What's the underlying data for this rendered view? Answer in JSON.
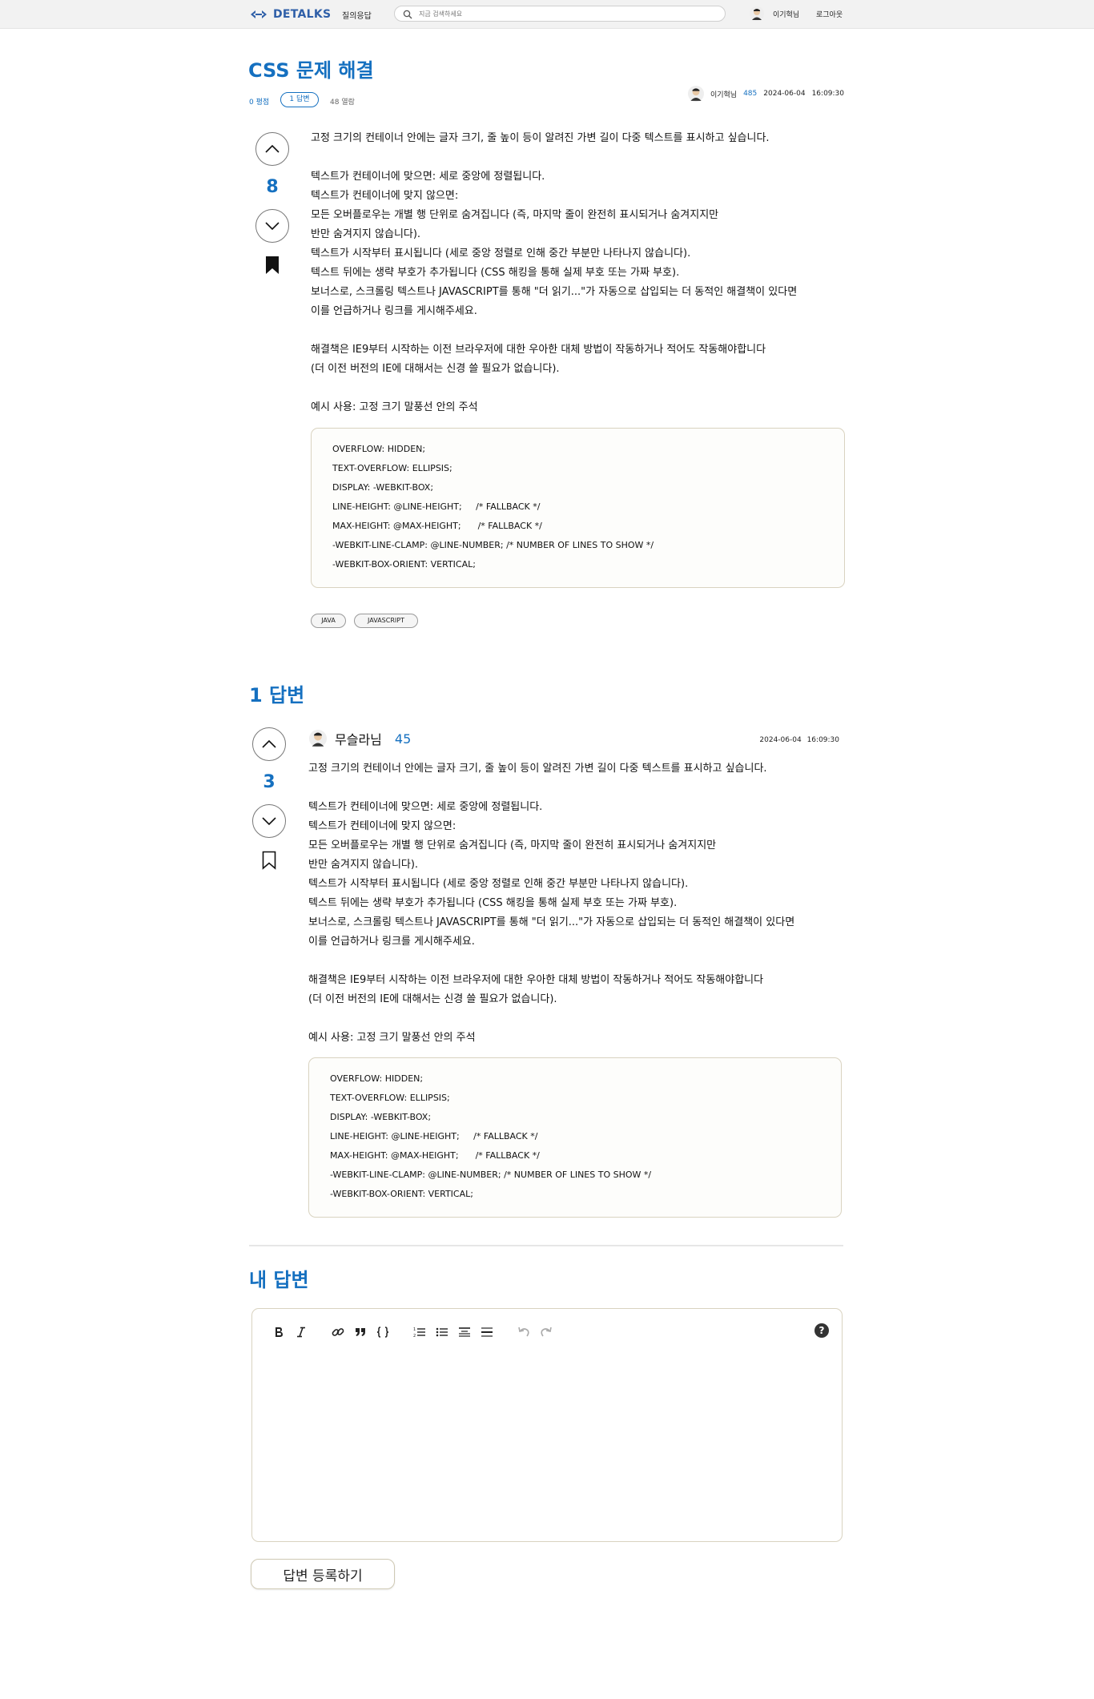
{
  "header": {
    "logo_text": "DETALKS",
    "nav_qa": "질의응답",
    "search_placeholder": "지금 검색하세요",
    "user_name": "이기혁님",
    "logout": "로그아웃"
  },
  "question": {
    "title": "CSS 문제 해결",
    "score": "0 평점",
    "answers": "1 답변",
    "views": "48 열람",
    "author": "이기혁님",
    "reputation": "485",
    "date": "2024-06-04",
    "time": "16:09:30",
    "votes": "8",
    "bookmarked": true,
    "body": "고정 크기의 컨테이너 안에는 글자 크기, 줄 높이 등이 알려진 가변 길이 다중 텍스트를 표시하고 싶습니다.\n\n텍스트가 컨테이너에 맞으면: 세로 중앙에 정렬됩니다.\n텍스트가 컨테이너에 맞지 않으면:\n모든 오버플로우는 개별 행 단위로 숨겨집니다 (즉, 마지막 줄이 완전히 표시되거나 숨겨지지만\n반만 숨겨지지 않습니다).\n텍스트가 시작부터 표시됩니다 (세로 중앙 정렬로 인해 중간 부분만 나타나지 않습니다).\n텍스트 뒤에는 생략 부호가 추가됩니다 (CSS 해킹을 통해 실제 부호 또는 가짜 부호).\n보너스로, 스크롤링 텍스트나 JAVASCRIPT를 통해 \"더 읽기...\"가 자동으로 삽입되는 더 동적인 해결책이 있다면\n이를 언급하거나 링크를 게시해주세요.\n\n해결책은 IE9부터 시작하는 이전 브라우저에 대한 우아한 대체 방법이 작동하거나 적어도 작동해야합니다\n(더 이전 버전의 IE에 대해서는 신경 쓸 필요가 없습니다).\n\n예시 사용: 고정 크기 말풍선 안의 주석",
    "code_lines": [
      "OVERFLOW: HIDDEN;",
      "TEXT-OVERFLOW: ELLIPSIS;",
      "DISPLAY: -WEBKIT-BOX;",
      "LINE-HEIGHT: @LINE-HEIGHT;     /* FALLBACK */",
      "MAX-HEIGHT: @MAX-HEIGHT;      /* FALLBACK */",
      "-WEBKIT-LINE-CLAMP: @LINE-NUMBER; /* NUMBER OF LINES TO SHOW */",
      "-WEBKIT-BOX-ORIENT: VERTICAL;"
    ],
    "tags": [
      "JAVA",
      "JAVASCRIPT"
    ]
  },
  "answers_section": {
    "title": "1 답변"
  },
  "answer": {
    "author": "무슬라님",
    "reputation": "45",
    "date": "2024-06-04",
    "time": "16:09:30",
    "votes": "3",
    "bookmarked": false,
    "body": "고정 크기의 컨테이너 안에는 글자 크기, 줄 높이 등이 알려진 가변 길이 다중 텍스트를 표시하고 싶습니다.\n\n텍스트가 컨테이너에 맞으면: 세로 중앙에 정렬됩니다.\n텍스트가 컨테이너에 맞지 않으면:\n모든 오버플로우는 개별 행 단위로 숨겨집니다 (즉, 마지막 줄이 완전히 표시되거나 숨겨지지만\n반만 숨겨지지 않습니다).\n텍스트가 시작부터 표시됩니다 (세로 중앙 정렬로 인해 중간 부분만 나타나지 않습니다).\n텍스트 뒤에는 생략 부호가 추가됩니다 (CSS 해킹을 통해 실제 부호 또는 가짜 부호).\n보너스로, 스크롤링 텍스트나 JAVASCRIPT를 통해 \"더 읽기...\"가 자동으로 삽입되는 더 동적인 해결책이 있다면\n이를 언급하거나 링크를 게시해주세요.\n\n해결책은 IE9부터 시작하는 이전 브라우저에 대한 우아한 대체 방법이 작동하거나 적어도 작동해야합니다\n(더 이전 버전의 IE에 대해서는 신경 쓸 필요가 없습니다).\n\n예시 사용: 고정 크기 말풍선 안의 주석",
    "code_lines": [
      "OVERFLOW: HIDDEN;",
      "TEXT-OVERFLOW: ELLIPSIS;",
      "DISPLAY: -WEBKIT-BOX;",
      "LINE-HEIGHT: @LINE-HEIGHT;     /* FALLBACK */",
      "MAX-HEIGHT: @MAX-HEIGHT;      /* FALLBACK */",
      "-WEBKIT-LINE-CLAMP: @LINE-NUMBER; /* NUMBER OF LINES TO SHOW */",
      "-WEBKIT-BOX-ORIENT: VERTICAL;"
    ]
  },
  "my_answer": {
    "title": "내 답변",
    "submit_label": "답변 등록하기",
    "help_label": "?"
  },
  "colors": {
    "accent": "#1570c0",
    "header_bg": "#f2f2f2"
  }
}
